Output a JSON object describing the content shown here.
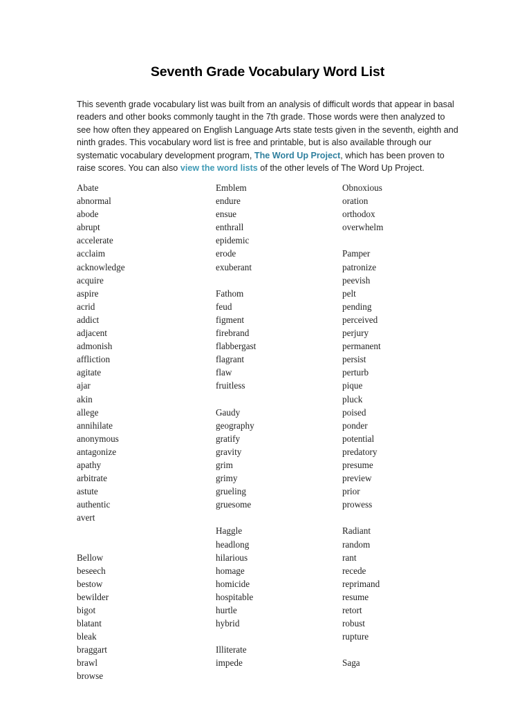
{
  "document": {
    "title": "Seventh Grade Vocabulary Word List",
    "intro": {
      "segment_1": "This seventh grade vocabulary list was built from an analysis of difficult words that appear in basal readers and other books commonly taught in the 7th grade. Those words were then analyzed to see how often they appeared on English Language Arts state tests given in the seventh, eighth and ninth grades. This vocabulary word list is free and printable, but is also available through our systematic vocabulary development program, ",
      "link_1": "The Word Up Project",
      "segment_2": ", which has been proven to raise scores. You can also ",
      "link_2": "view the word lists",
      "segment_3": " of the other levels of The Word Up Project."
    },
    "colors": {
      "link_primary": "#2e7f9e",
      "link_secondary": "#3f9ab5",
      "body_text": "#232323",
      "page_background": "#ffffff"
    },
    "columns": [
      {
        "name": "column-1",
        "entries": [
          "Abate",
          "abnormal",
          "abode",
          "abrupt",
          "accelerate",
          "acclaim",
          "acknowledge",
          "acquire",
          "aspire",
          "acrid",
          "addict",
          "adjacent",
          "admonish",
          "affliction",
          "agitate",
          "ajar",
          "akin",
          "allege",
          "annihilate",
          "anonymous",
          "antagonize",
          "apathy",
          "arbitrate",
          "astute",
          "authentic",
          "avert",
          "",
          "",
          "Bellow",
          "beseech",
          "bestow",
          "bewilder",
          "bigot",
          "blatant",
          "bleak",
          "braggart",
          "brawl",
          "browse"
        ]
      },
      {
        "name": "column-2",
        "entries": [
          "Emblem",
          "endure",
          "ensue",
          "enthrall",
          "epidemic",
          "erode",
          "exuberant",
          "",
          "Fathom",
          "feud",
          "figment",
          "firebrand",
          "flabbergast",
          "flagrant",
          "flaw",
          "fruitless",
          "",
          "Gaudy",
          "geography",
          "gratify",
          "gravity",
          "grim",
          "grimy",
          "grueling",
          "gruesome",
          "",
          "Haggle",
          "headlong",
          "hilarious",
          "homage",
          "homicide",
          "hospitable",
          "hurtle",
          "hybrid",
          "",
          "Illiterate",
          "impede"
        ]
      },
      {
        "name": "column-3",
        "entries": [
          "Obnoxious",
          "oration",
          "orthodox",
          "overwhelm",
          "",
          "Pamper",
          "patronize",
          "peevish",
          "pelt",
          "pending",
          "perceived",
          "perjury",
          "permanent",
          "persist",
          "perturb",
          "pique",
          "pluck",
          "poised",
          "ponder",
          "potential",
          "predatory",
          "presume",
          "preview",
          "prior",
          "prowess",
          "",
          "Radiant",
          "random",
          "rant",
          "recede",
          "reprimand",
          "resume",
          "retort",
          "robust",
          "rupture",
          "",
          "Saga"
        ]
      }
    ]
  }
}
